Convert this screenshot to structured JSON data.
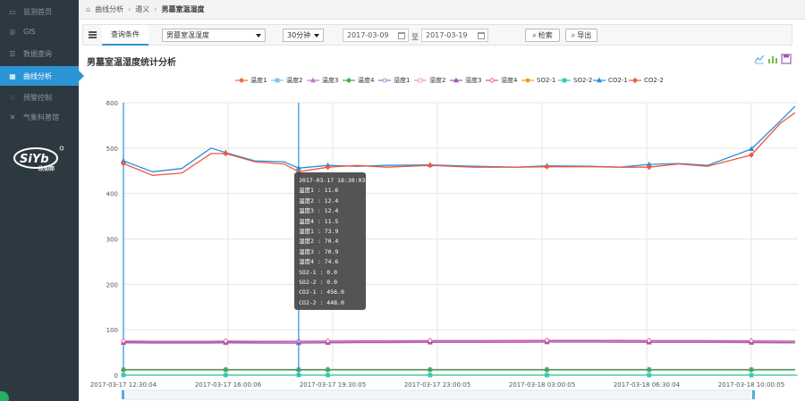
{
  "sidebar": {
    "items": [
      {
        "label": "监测首页",
        "icon": "monitor-icon"
      },
      {
        "label": "GIS",
        "icon": "globe-icon"
      },
      {
        "label": "数据查询",
        "icon": "list-icon"
      },
      {
        "label": "曲线分析",
        "icon": "curve-chart-icon",
        "active": true
      },
      {
        "label": "预警控制",
        "icon": "alert-icon"
      },
      {
        "label": "气象科普馆",
        "icon": "science-icon"
      }
    ],
    "logo_text": "欣仰邦",
    "logo_brand": "SiYb"
  },
  "breadcrumb": {
    "items": [
      "曲线分析",
      "遵义",
      "男墓室温湿度"
    ]
  },
  "query": {
    "tab_label": "查询条件",
    "site_select": "男墓室温湿度",
    "interval_select": "30分钟",
    "date_from": "2017-03-09",
    "date_to_label": "至",
    "date_to": "2017-03-19",
    "search_label": "检索",
    "export_label": "导出"
  },
  "section": {
    "title": "男墓室温湿度统计分析"
  },
  "colors": {
    "accent": "#2c95d6",
    "sidebar_bg": "#2d3941"
  },
  "chart_data": {
    "type": "line",
    "ylim": [
      0,
      600
    ],
    "yticks": [
      0,
      100,
      200,
      300,
      400,
      500,
      600
    ],
    "xticks": [
      "2017-03-17 12:30:04",
      "2017-03-17 16:00:06",
      "2017-03-17 19:30:05",
      "2017-03-17 23:00:05",
      "2017-03-18 03:00:05",
      "2017-03-18 06:30:04",
      "2017-03-18 10:00:05"
    ],
    "grid": true,
    "legend_position": "top",
    "x": [
      "2017-03-17 12:30:04",
      "2017-03-17 13:30:00",
      "2017-03-17 14:30:00",
      "2017-03-17 15:30:00",
      "2017-03-17 16:00:06",
      "2017-03-17 17:00:00",
      "2017-03-17 18:00:00",
      "2017-03-17 18:30:03",
      "2017-03-17 19:30:05",
      "2017-03-17 20:30:00",
      "2017-03-17 21:30:00",
      "2017-03-17 23:00:05",
      "2017-03-18 00:30:00",
      "2017-03-18 02:00:00",
      "2017-03-18 03:00:05",
      "2017-03-18 04:30:00",
      "2017-03-18 05:30:00",
      "2017-03-18 06:30:04",
      "2017-03-18 07:30:00",
      "2017-03-18 08:30:00",
      "2017-03-18 10:00:05",
      "2017-03-18 11:00:00",
      "2017-03-18 11:30:00"
    ],
    "series": [
      {
        "name": "温度1",
        "color": "#f06a3a",
        "marker": "circle",
        "values": [
          12,
          12,
          12,
          12,
          12,
          12,
          12,
          11.6,
          12,
          12,
          12,
          12,
          12,
          12,
          12,
          12,
          12,
          12,
          12,
          12,
          12,
          12,
          12
        ]
      },
      {
        "name": "温度2",
        "color": "#7cc4f2",
        "marker": "square",
        "values": [
          12.4,
          12.4,
          12.4,
          12.4,
          12.4,
          12.4,
          12.4,
          12.4,
          12.4,
          12.4,
          12.4,
          12.4,
          12.4,
          12.4,
          12.4,
          12.4,
          12.4,
          12.4,
          12.4,
          12.4,
          12.4,
          12.4,
          12.4
        ]
      },
      {
        "name": "温度3",
        "color": "#c875d6",
        "marker": "triangle",
        "values": [
          12.4,
          12.4,
          12.4,
          12.4,
          12.4,
          12.4,
          12.4,
          12.4,
          12.4,
          12.4,
          12.4,
          12.4,
          12.4,
          12.4,
          12.4,
          12.4,
          12.4,
          12.4,
          12.4,
          12.4,
          12.4,
          12.4,
          12.4
        ]
      },
      {
        "name": "温度4",
        "color": "#3fae49",
        "marker": "diamond",
        "values": [
          11.5,
          11.5,
          11.5,
          11.5,
          11.5,
          11.5,
          11.5,
          11.5,
          11.5,
          11.5,
          11.5,
          11.5,
          11.5,
          11.5,
          11.5,
          11.5,
          11.5,
          11.5,
          11.5,
          11.5,
          11.5,
          11.5,
          11.5
        ]
      },
      {
        "name": "湿度1",
        "color": "#5b8fd6",
        "marker": "circle-open",
        "values": [
          74,
          73.5,
          73.5,
          73.5,
          74,
          73.5,
          73.8,
          73.9,
          74.5,
          75,
          75,
          75.5,
          75.5,
          75.8,
          76,
          76,
          75.8,
          75.5,
          75.5,
          75.5,
          75,
          74.5,
          74.5
        ]
      },
      {
        "name": "湿度2",
        "color": "#f08cc8",
        "marker": "square-open",
        "values": [
          71,
          70.5,
          70.5,
          70.5,
          71,
          70.5,
          70.4,
          70.4,
          71,
          71.5,
          71.5,
          72,
          72,
          72.2,
          72.5,
          72.5,
          72.3,
          72,
          72,
          72,
          71.5,
          71,
          71
        ]
      },
      {
        "name": "湿度3",
        "color": "#9b59b6",
        "marker": "triangle",
        "values": [
          71.5,
          71,
          71,
          71,
          71.5,
          71,
          70.9,
          70.9,
          71.5,
          72,
          72,
          72.5,
          72.5,
          72.7,
          73,
          73,
          72.8,
          72.5,
          72.5,
          72.5,
          72,
          71.5,
          71.5
        ]
      },
      {
        "name": "湿度4",
        "color": "#e74c8c",
        "marker": "diamond-open",
        "values": [
          75,
          74.5,
          74.5,
          74.5,
          75,
          74.6,
          74.6,
          74.6,
          75,
          75.5,
          75.5,
          76,
          76,
          76.2,
          76.5,
          76.5,
          76.3,
          76,
          76,
          76,
          75.5,
          75,
          75
        ]
      },
      {
        "name": "SO2-1",
        "color": "#f39c12",
        "marker": "circle",
        "values": [
          0,
          0,
          0,
          0,
          0,
          0,
          0,
          0,
          0,
          0,
          0,
          0,
          0,
          0,
          0,
          0,
          0,
          0,
          0,
          0,
          0,
          0,
          0
        ]
      },
      {
        "name": "SO2-2",
        "color": "#2ecdb9",
        "marker": "square",
        "values": [
          0,
          0,
          0,
          0,
          0,
          0,
          0,
          0,
          0,
          0,
          0,
          0,
          0,
          0,
          0,
          0,
          0,
          0,
          0,
          0,
          0,
          0,
          0
        ]
      },
      {
        "name": "CO2-1",
        "color": "#2b8fd9",
        "marker": "triangle",
        "values": [
          472,
          448,
          455,
          500,
          490,
          472,
          470,
          456,
          462,
          460,
          462,
          463,
          460,
          458,
          461,
          460,
          458,
          464,
          466,
          462,
          498,
          560,
          592
        ]
      },
      {
        "name": "CO2-2",
        "color": "#ee5a3c",
        "marker": "diamond",
        "values": [
          466,
          440,
          445,
          488,
          488,
          470,
          465,
          448,
          458,
          462,
          458,
          462,
          458,
          458,
          459,
          459,
          458,
          458,
          465,
          460,
          485,
          555,
          578
        ]
      }
    ],
    "tooltip": {
      "time": "2017-03-17 18:30:03",
      "rows": [
        {
          "name": "温度1",
          "value": "11.6"
        },
        {
          "name": "温度2",
          "value": "12.4"
        },
        {
          "name": "温度3",
          "value": "12.4"
        },
        {
          "name": "温度4",
          "value": "11.5"
        },
        {
          "name": "湿度1",
          "value": "73.9"
        },
        {
          "name": "湿度2",
          "value": "70.4"
        },
        {
          "name": "湿度3",
          "value": "70.9"
        },
        {
          "name": "湿度4",
          "value": "74.6"
        },
        {
          "name": "SO2-1",
          "value": "0.0"
        },
        {
          "name": "SO2-2",
          "value": "0.0"
        },
        {
          "name": "CO2-1",
          "value": "456.0"
        },
        {
          "name": "CO2-2",
          "value": "448.0"
        }
      ]
    }
  }
}
